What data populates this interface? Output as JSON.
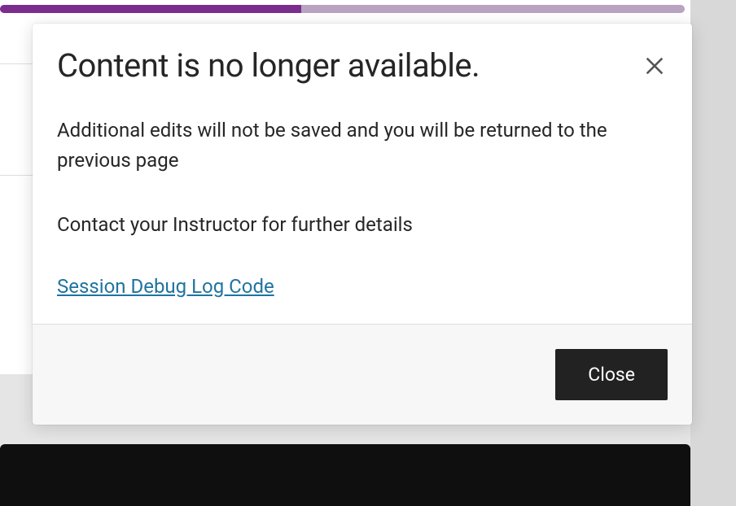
{
  "progress": {
    "percent": 44
  },
  "modal": {
    "title": "Content is no longer available.",
    "body_line1": "Additional edits will not be saved and you will be returned to the previous page",
    "body_line2": "Contact your Instructor for further details",
    "debug_link_label": "Session Debug Log Code",
    "close_button_label": "Close"
  }
}
